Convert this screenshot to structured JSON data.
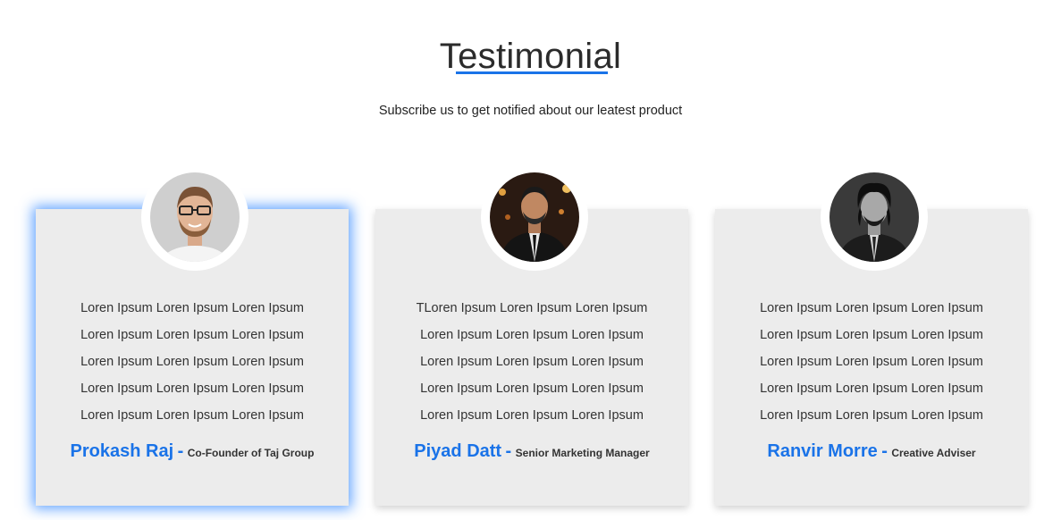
{
  "header": {
    "title": "Testimonial",
    "subtitle": "Subscribe us to get notified about our leatest product"
  },
  "colors": {
    "accent": "#1a73e8",
    "card_bg": "#ececec",
    "active_glow": "#2882ff"
  },
  "testimonials": [
    {
      "lines": [
        "Loren Ipsum Loren Ipsum Loren Ipsum",
        "Loren Ipsum Loren Ipsum Loren Ipsum",
        "Loren Ipsum Loren Ipsum Loren Ipsum",
        "Loren Ipsum Loren Ipsum Loren Ipsum",
        "Loren Ipsum Loren Ipsum Loren Ipsum"
      ],
      "name": "Prokash Raj",
      "separator": "-",
      "role": "Co-Founder of Taj Group",
      "active": true
    },
    {
      "lines": [
        "TLoren Ipsum Loren Ipsum Loren Ipsum",
        "Loren Ipsum Loren Ipsum Loren Ipsum",
        "Loren Ipsum Loren Ipsum Loren Ipsum",
        "Loren Ipsum Loren Ipsum Loren Ipsum",
        "Loren Ipsum Loren Ipsum Loren Ipsum"
      ],
      "name": "Piyad Datt",
      "separator": "-",
      "role": "Senior Marketing Manager",
      "active": false
    },
    {
      "lines": [
        "Loren Ipsum Loren Ipsum Loren Ipsum",
        "Loren Ipsum Loren Ipsum Loren Ipsum",
        "Loren Ipsum Loren Ipsum Loren Ipsum",
        "Loren Ipsum Loren Ipsum Loren Ipsum",
        "Loren Ipsum Loren Ipsum Loren Ipsum"
      ],
      "name": "Ranvir Morre",
      "separator": "-",
      "role": "Creative Adviser",
      "active": false
    }
  ]
}
